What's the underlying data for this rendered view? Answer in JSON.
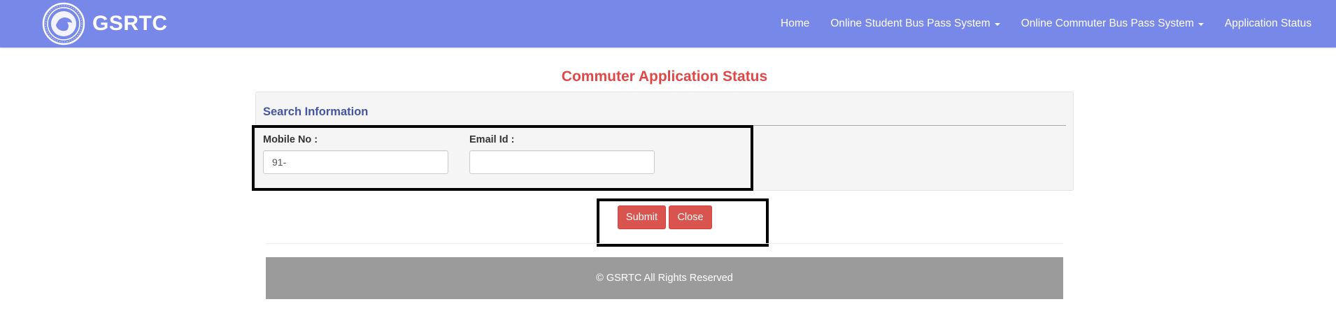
{
  "brand": {
    "name": "GSRTC",
    "logo_icon": "gsrtc-emblem-icon"
  },
  "nav": {
    "items": [
      {
        "label": "Home",
        "dropdown": false
      },
      {
        "label": "Online Student Bus Pass System",
        "dropdown": true
      },
      {
        "label": "Online Commuter Bus Pass System",
        "dropdown": true
      },
      {
        "label": "Application Status",
        "dropdown": false
      }
    ]
  },
  "page": {
    "title": "Commuter Application Status"
  },
  "search": {
    "heading": "Search Information",
    "mobile": {
      "label": "Mobile No :",
      "value": "91-",
      "placeholder": ""
    },
    "email": {
      "label": "Email Id :",
      "value": "",
      "placeholder": ""
    }
  },
  "actions": {
    "submit_label": "Submit",
    "close_label": "Close"
  },
  "footer": {
    "text": "© GSRTC All Rights Reserved"
  },
  "colors": {
    "navbar": "#7788e8",
    "title": "#e04848",
    "heading": "#4355a3",
    "button": "#d9534f",
    "footer": "#9b9b9b"
  }
}
